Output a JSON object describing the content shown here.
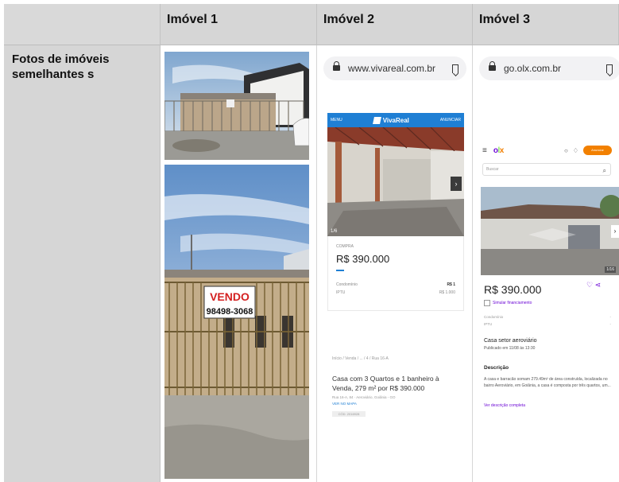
{
  "header": {
    "col1": "Imóvel 1",
    "col2": "Imóvel 2",
    "col3": "Imóvel 3"
  },
  "row": {
    "label": "Fotos de imóveis semelhantes s"
  },
  "imovel1": {
    "sign_line1": "VENDO",
    "sign_line2": "98498-3068"
  },
  "imovel2": {
    "url": "www.vivareal.com.br",
    "header_left": "MENU",
    "brand": "VivaReal",
    "header_right": "ANUNCIAR",
    "photo_count": "1/6",
    "card_label": "COMPRA",
    "price": "R$ 390.000",
    "condo_label": "Condomínio",
    "condo_value": "R$ 1",
    "iptu_label": "IPTU",
    "iptu_value": "R$ 1.000",
    "breadcrumb": "Início / Venda / ... / 4 / Rua 16-A",
    "title": "Casa com 3 Quartos e 1 banheiro à Venda, 279 m² por R$ 390.000",
    "address": "Rua 16-A, 84 · Aeroviário, Goiânia - GO",
    "map_link": "VER NO MAPA",
    "tag": "CÓD. 2016928"
  },
  "imovel3": {
    "url": "go.olx.com.br",
    "search_placeholder": "Buscar",
    "post_button": "Anunciar",
    "photo_count": "1/16",
    "price": "R$ 390.000",
    "simulate": "Simular financiamento",
    "condo_label": "Condomínio",
    "iptu_label": "IPTU",
    "title": "Casa setor aeroviário",
    "published": "Publicado em 11/08 às 13:30",
    "desc_heading": "Descrição",
    "description": "A casa e barracão somam 279.49m² de área construída, localizada no bairro Aeroviário, em Goiânia, a casa é composta por três quartos, um...",
    "more_link": "Ver descrição completa"
  },
  "colors": {
    "header_bg": "#d6d6d6",
    "vivareal_blue": "#1f7fd4",
    "olx_purple": "#6e0ad6",
    "olx_orange": "#f28000",
    "sign_red": "#d42020"
  }
}
